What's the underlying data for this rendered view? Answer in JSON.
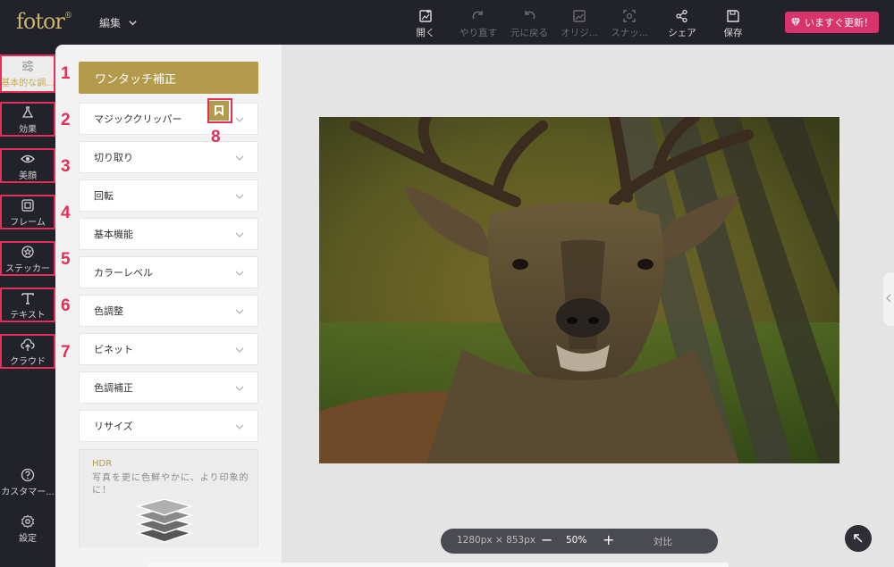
{
  "app": {
    "logo": "fotor",
    "logo_mark": "®",
    "edit_menu": "編集"
  },
  "toolbar": {
    "open": "開く",
    "redo": "やり直す",
    "undo": "元に戻る",
    "original": "オリジ...",
    "snapshot": "スナッ...",
    "share": "シェア",
    "save": "保存",
    "upgrade": "いますぐ更新！"
  },
  "rail": {
    "items": [
      {
        "label": "基本的な調...",
        "num": "1",
        "icon": "sliders-icon"
      },
      {
        "label": "効果",
        "num": "2",
        "icon": "flask-icon"
      },
      {
        "label": "美顔",
        "num": "3",
        "icon": "eye-icon"
      },
      {
        "label": "フレーム",
        "num": "4",
        "icon": "frame-icon"
      },
      {
        "label": "ステッカー",
        "num": "5",
        "icon": "sticker-icon"
      },
      {
        "label": "テキスト",
        "num": "6",
        "icon": "text-icon"
      },
      {
        "label": "クラウド",
        "num": "7",
        "icon": "cloud-upload-icon"
      }
    ],
    "support": "カスタマー...",
    "settings": "設定"
  },
  "panel": {
    "one_touch": "ワンタッチ補正",
    "sections": [
      "マジッククリッパー",
      "切り取り",
      "回転",
      "基本機能",
      "カラーレベル",
      "色調整",
      "ビネット",
      "色調補正",
      "リサイズ"
    ],
    "bookmark_num": "8",
    "hdr": {
      "title": "HDR",
      "desc": "写真を更に色鮮やかに、より印象的に！"
    }
  },
  "canvas": {
    "size": "1280px × 853px",
    "minus": "−",
    "zoom": "50%",
    "plus": "+",
    "compare": "対比"
  },
  "colors": {
    "accent_gold": "#b39b4b",
    "annotation_red": "#e62e56",
    "upgrade_pink": "#d8336b"
  }
}
